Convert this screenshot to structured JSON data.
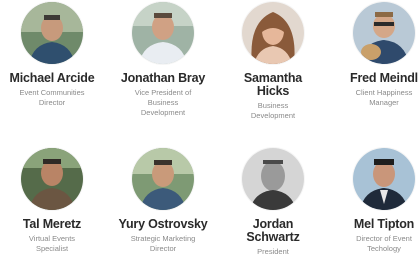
{
  "team": [
    {
      "name": "Michael Arcide",
      "title": "Event Communities Director"
    },
    {
      "name": "Jonathan Bray",
      "title": "Vice President of Business Development"
    },
    {
      "name": "Samantha Hicks",
      "title": "Business Development"
    },
    {
      "name": "Fred Meindl",
      "title": "Client Happiness Manager"
    },
    {
      "name": "Tal Meretz",
      "title": "Virtual Events Specialist"
    },
    {
      "name": "Yury Ostrovsky",
      "title": "Strategic Marketing Director"
    },
    {
      "name": "Jordan Schwartz",
      "title": "President"
    },
    {
      "name": "Mel Tipton",
      "title": "Director of Event Techology"
    }
  ]
}
